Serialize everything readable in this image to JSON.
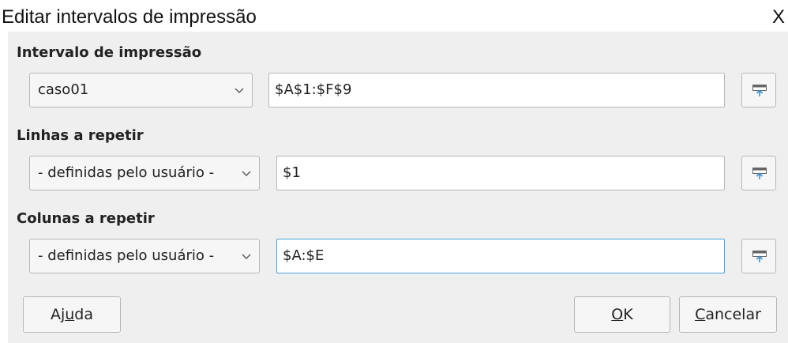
{
  "window": {
    "title": "Editar intervalos de impressão",
    "close_label": "X"
  },
  "sections": [
    {
      "label": "Intervalo de impressão",
      "combo_value": "caso01",
      "field_value": "$A$1:$F$9"
    },
    {
      "label": "Linhas a repetir",
      "combo_value": "- definidas pelo usuário -",
      "field_value": "$1"
    },
    {
      "label": "Colunas a repetir",
      "combo_value": "- definidas pelo usuário -",
      "field_value": "$A:$E"
    }
  ],
  "buttons": {
    "help": {
      "pre": "Aj",
      "mnemonic": "u",
      "post": "da"
    },
    "ok": {
      "pre": "",
      "mnemonic": "O",
      "post": "K"
    },
    "cancel": {
      "pre": "",
      "mnemonic": "C",
      "post": "ancelar"
    }
  },
  "icons": {
    "combo_arrow": "chevron-down-icon",
    "shrink": "shrink-dialog-icon"
  },
  "colors": {
    "dialog_bg": "#efefef",
    "focus_border": "#4ca3d6",
    "shrink_arrow": "#3d8fd1"
  }
}
